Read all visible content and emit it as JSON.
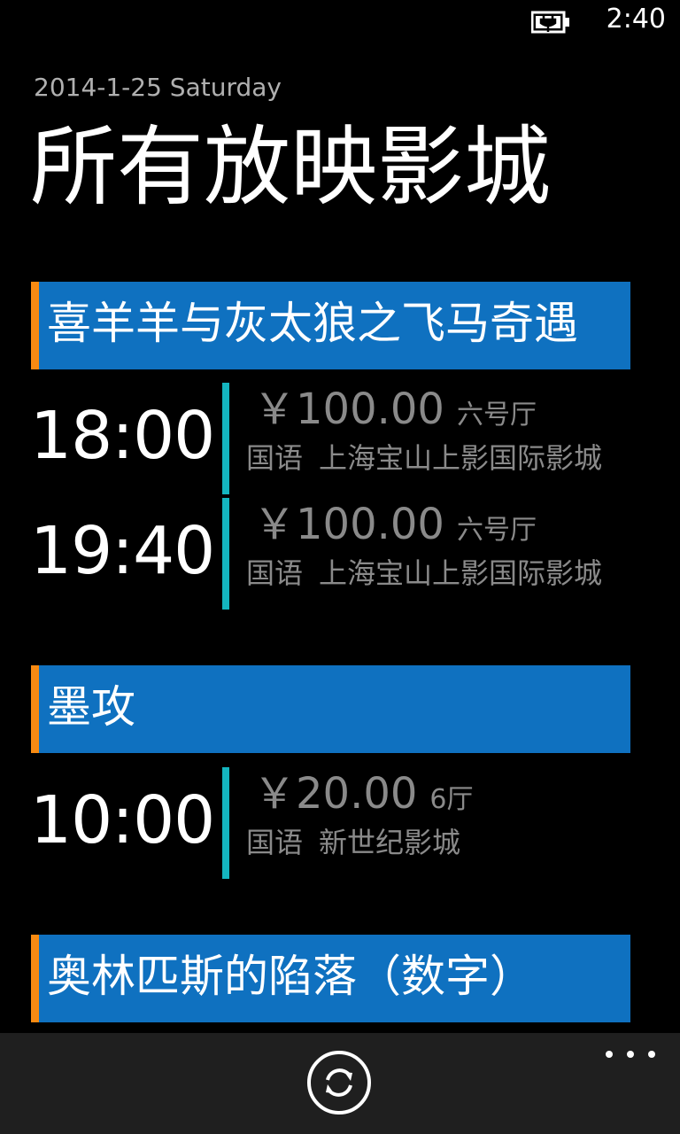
{
  "status_bar": {
    "time": "2:40",
    "battery_icon": "battery-charging-icon"
  },
  "header": {
    "date": "2014-1-25 Saturday",
    "title": "所有放映影城"
  },
  "colors": {
    "header_bar": "#0f71c0",
    "accent": "#f78a12",
    "time_bar": "#14b5bf",
    "secondary_text": "#8a8a8a"
  },
  "movies": [
    {
      "title": "喜羊羊与灰太狼之飞马奇遇",
      "showtimes": [
        {
          "time": "18:00",
          "price": "￥100.00",
          "hall": "六号厅",
          "language": "国语",
          "cinema": "上海宝山上影国际影城"
        },
        {
          "time": "19:40",
          "price": "￥100.00",
          "hall": "六号厅",
          "language": "国语",
          "cinema": "上海宝山上影国际影城"
        }
      ]
    },
    {
      "title": "墨攻",
      "showtimes": [
        {
          "time": "10:00",
          "price": "￥20.00",
          "hall": "6厅",
          "language": "国语",
          "cinema": "新世纪影城"
        }
      ]
    },
    {
      "title": "奥林匹斯的陷落（数字）",
      "showtimes": []
    }
  ],
  "app_bar": {
    "refresh_icon": "refresh-icon",
    "more_icon": "more-icon"
  }
}
